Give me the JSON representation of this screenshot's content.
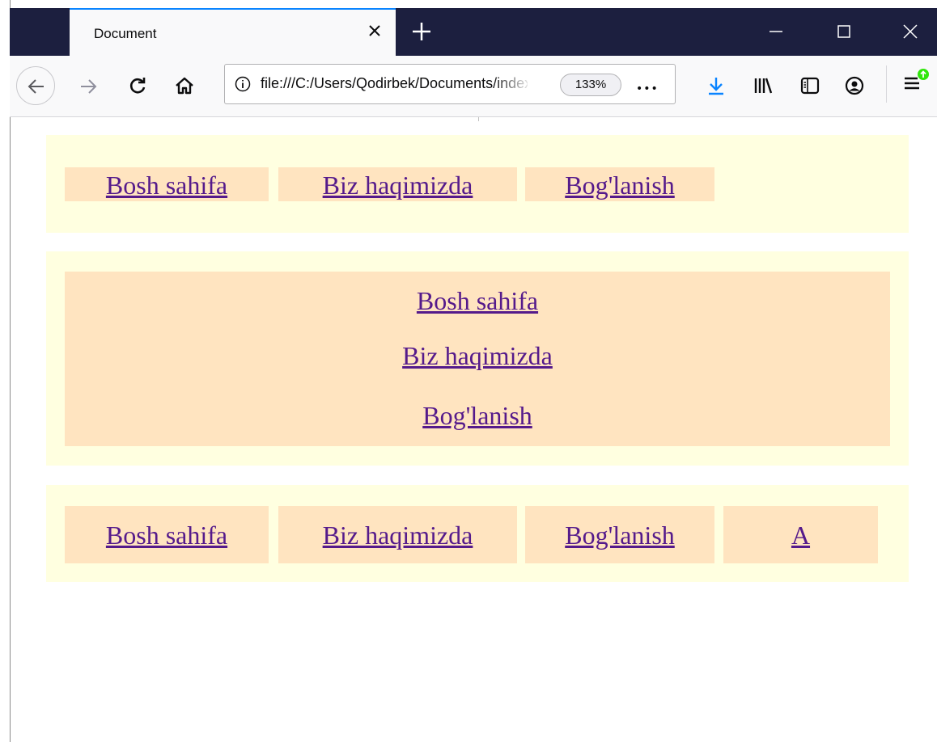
{
  "browser": {
    "tab_title": "Document",
    "url": "file:///C:/Users/Qodirbek/Documents/index.html",
    "zoom": "133%",
    "more_label": "•••"
  },
  "horizontal_menu": {
    "items": [
      "Bosh sahifa",
      "Biz haqimizda",
      "Bog'lanish"
    ]
  },
  "vertical_menu": {
    "items": [
      "Bosh sahifa",
      "Biz haqimizda",
      "Bog'lanish"
    ]
  },
  "flex_menu": {
    "items": [
      "Bosh sahifa",
      "Biz haqimizda",
      "Bog'lanish",
      "A"
    ]
  },
  "colors": {
    "block_bg": "#ffffe0",
    "item_bg": "#ffe4c0",
    "link": "#551a8b",
    "accent": "#0a84ff"
  }
}
